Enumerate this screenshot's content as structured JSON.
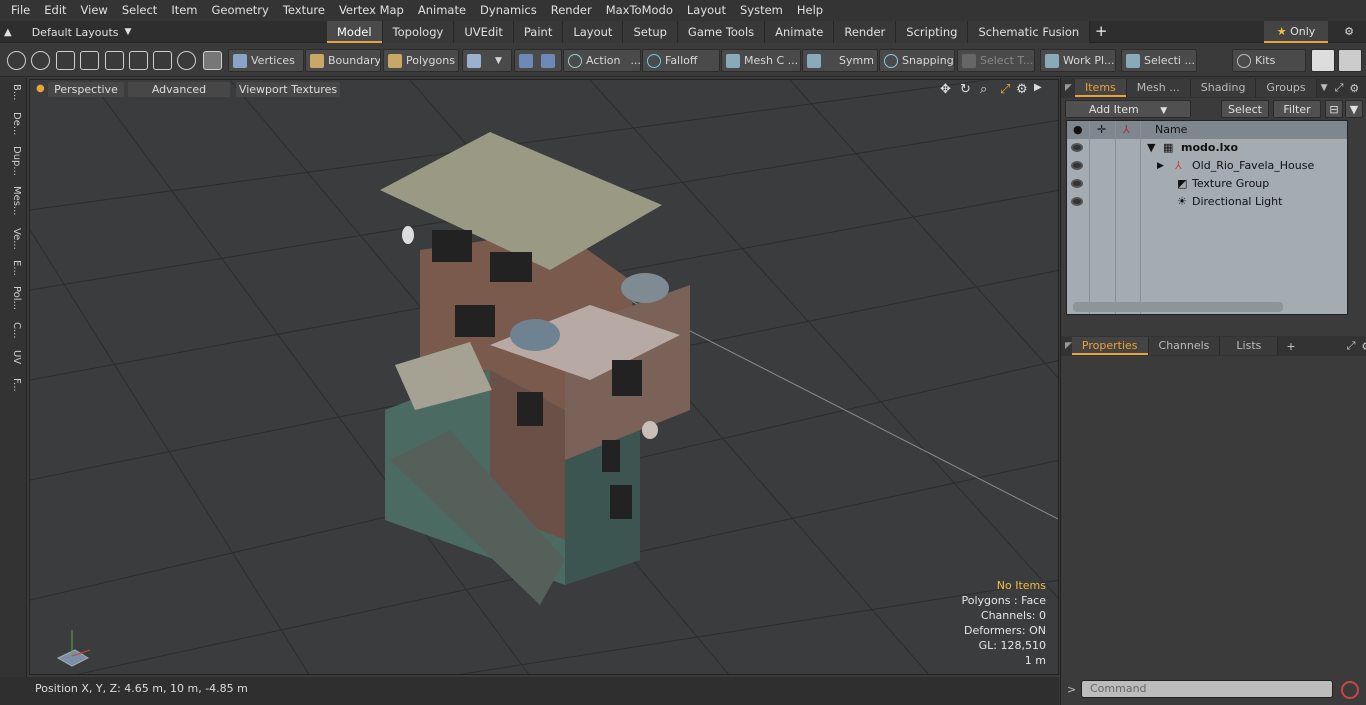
{
  "menu": [
    "File",
    "Edit",
    "View",
    "Select",
    "Item",
    "Geometry",
    "Texture",
    "Vertex Map",
    "Animate",
    "Dynamics",
    "Render",
    "MaxToModo",
    "Layout",
    "System",
    "Help"
  ],
  "layouts": {
    "label": "Default Layouts"
  },
  "tabs": [
    "Model",
    "Topology",
    "UVEdit",
    "Paint",
    "Layout",
    "Setup",
    "Game Tools",
    "Animate",
    "Render",
    "Scripting",
    "Schematic Fusion"
  ],
  "only_label": "Only",
  "toolbar": {
    "vertices": "Vertices",
    "boundary": "Boundary",
    "polygons": "Polygons",
    "action": "Action",
    "falloff": "Falloff",
    "mesh": "Mesh C ...",
    "symm": "Symm ...",
    "snapping": "Snapping",
    "select_t": "Select T...",
    "work": "Work Pl...",
    "selecti": "Selecti ...",
    "kits": "Kits"
  },
  "left_tabs": [
    "B...",
    "De...",
    "Dup...",
    "Mes...",
    "Ve...",
    "E...",
    "Pol...",
    "C...",
    "UV",
    "F..."
  ],
  "viewport": {
    "perspective": "Perspective",
    "advanced": "Advanced",
    "textures": "Viewport Textures",
    "info": {
      "warn": "No Items",
      "l1": "Polygons : Face",
      "l2": "Channels: 0",
      "l3": "Deformers: ON",
      "l4": "GL: 128,510",
      "l5": "1 m"
    }
  },
  "status": {
    "position": "Position X, Y, Z:   4.65 m, 10 m, -4.85 m"
  },
  "panel": {
    "tabs": [
      "Items",
      "Mesh ...",
      "Shading",
      "Groups"
    ],
    "add_item": "Add Item",
    "select": "Select",
    "filter": "Filter",
    "col_name": "Name",
    "items": [
      {
        "label": "modo.lxo"
      },
      {
        "label": "Old_Rio_Favela_House"
      },
      {
        "label": "Texture Group"
      },
      {
        "label": "Directional Light"
      }
    ],
    "lower_tabs": [
      "Properties",
      "Channels",
      "Lists"
    ],
    "command_placeholder": "Command"
  },
  "colors": {
    "accent": "#e8a33d",
    "viewport_bg": "#3a3c3d"
  }
}
